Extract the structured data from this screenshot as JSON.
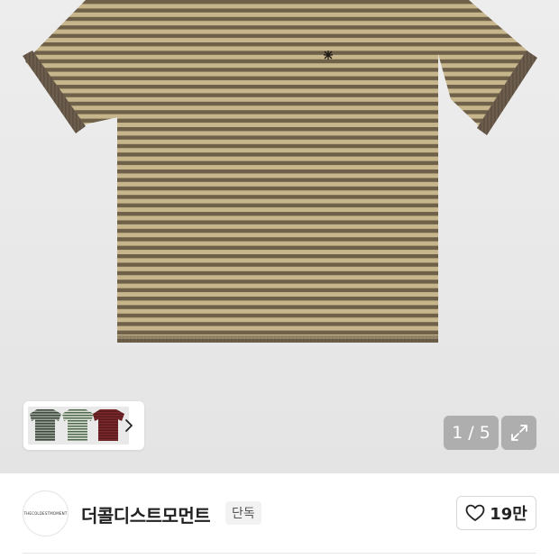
{
  "gallery": {
    "image_alt": "striped short sleeve t-shirt",
    "counter_current": "1",
    "counter_separator": "/",
    "counter_total": "5",
    "thumbnail_colors": [
      "#3e4a3c",
      "#4f6a4e",
      "#6b1f22"
    ]
  },
  "shop": {
    "logo_text": "THECOLDESTMOMENT",
    "brand_name": "더콜디스트모먼트",
    "badge": "단독",
    "likes": "19만"
  },
  "colors": {
    "stripe_light": "#c9b88f",
    "stripe_dark": "#6b5e47",
    "cuff": "#6d5e4c"
  }
}
